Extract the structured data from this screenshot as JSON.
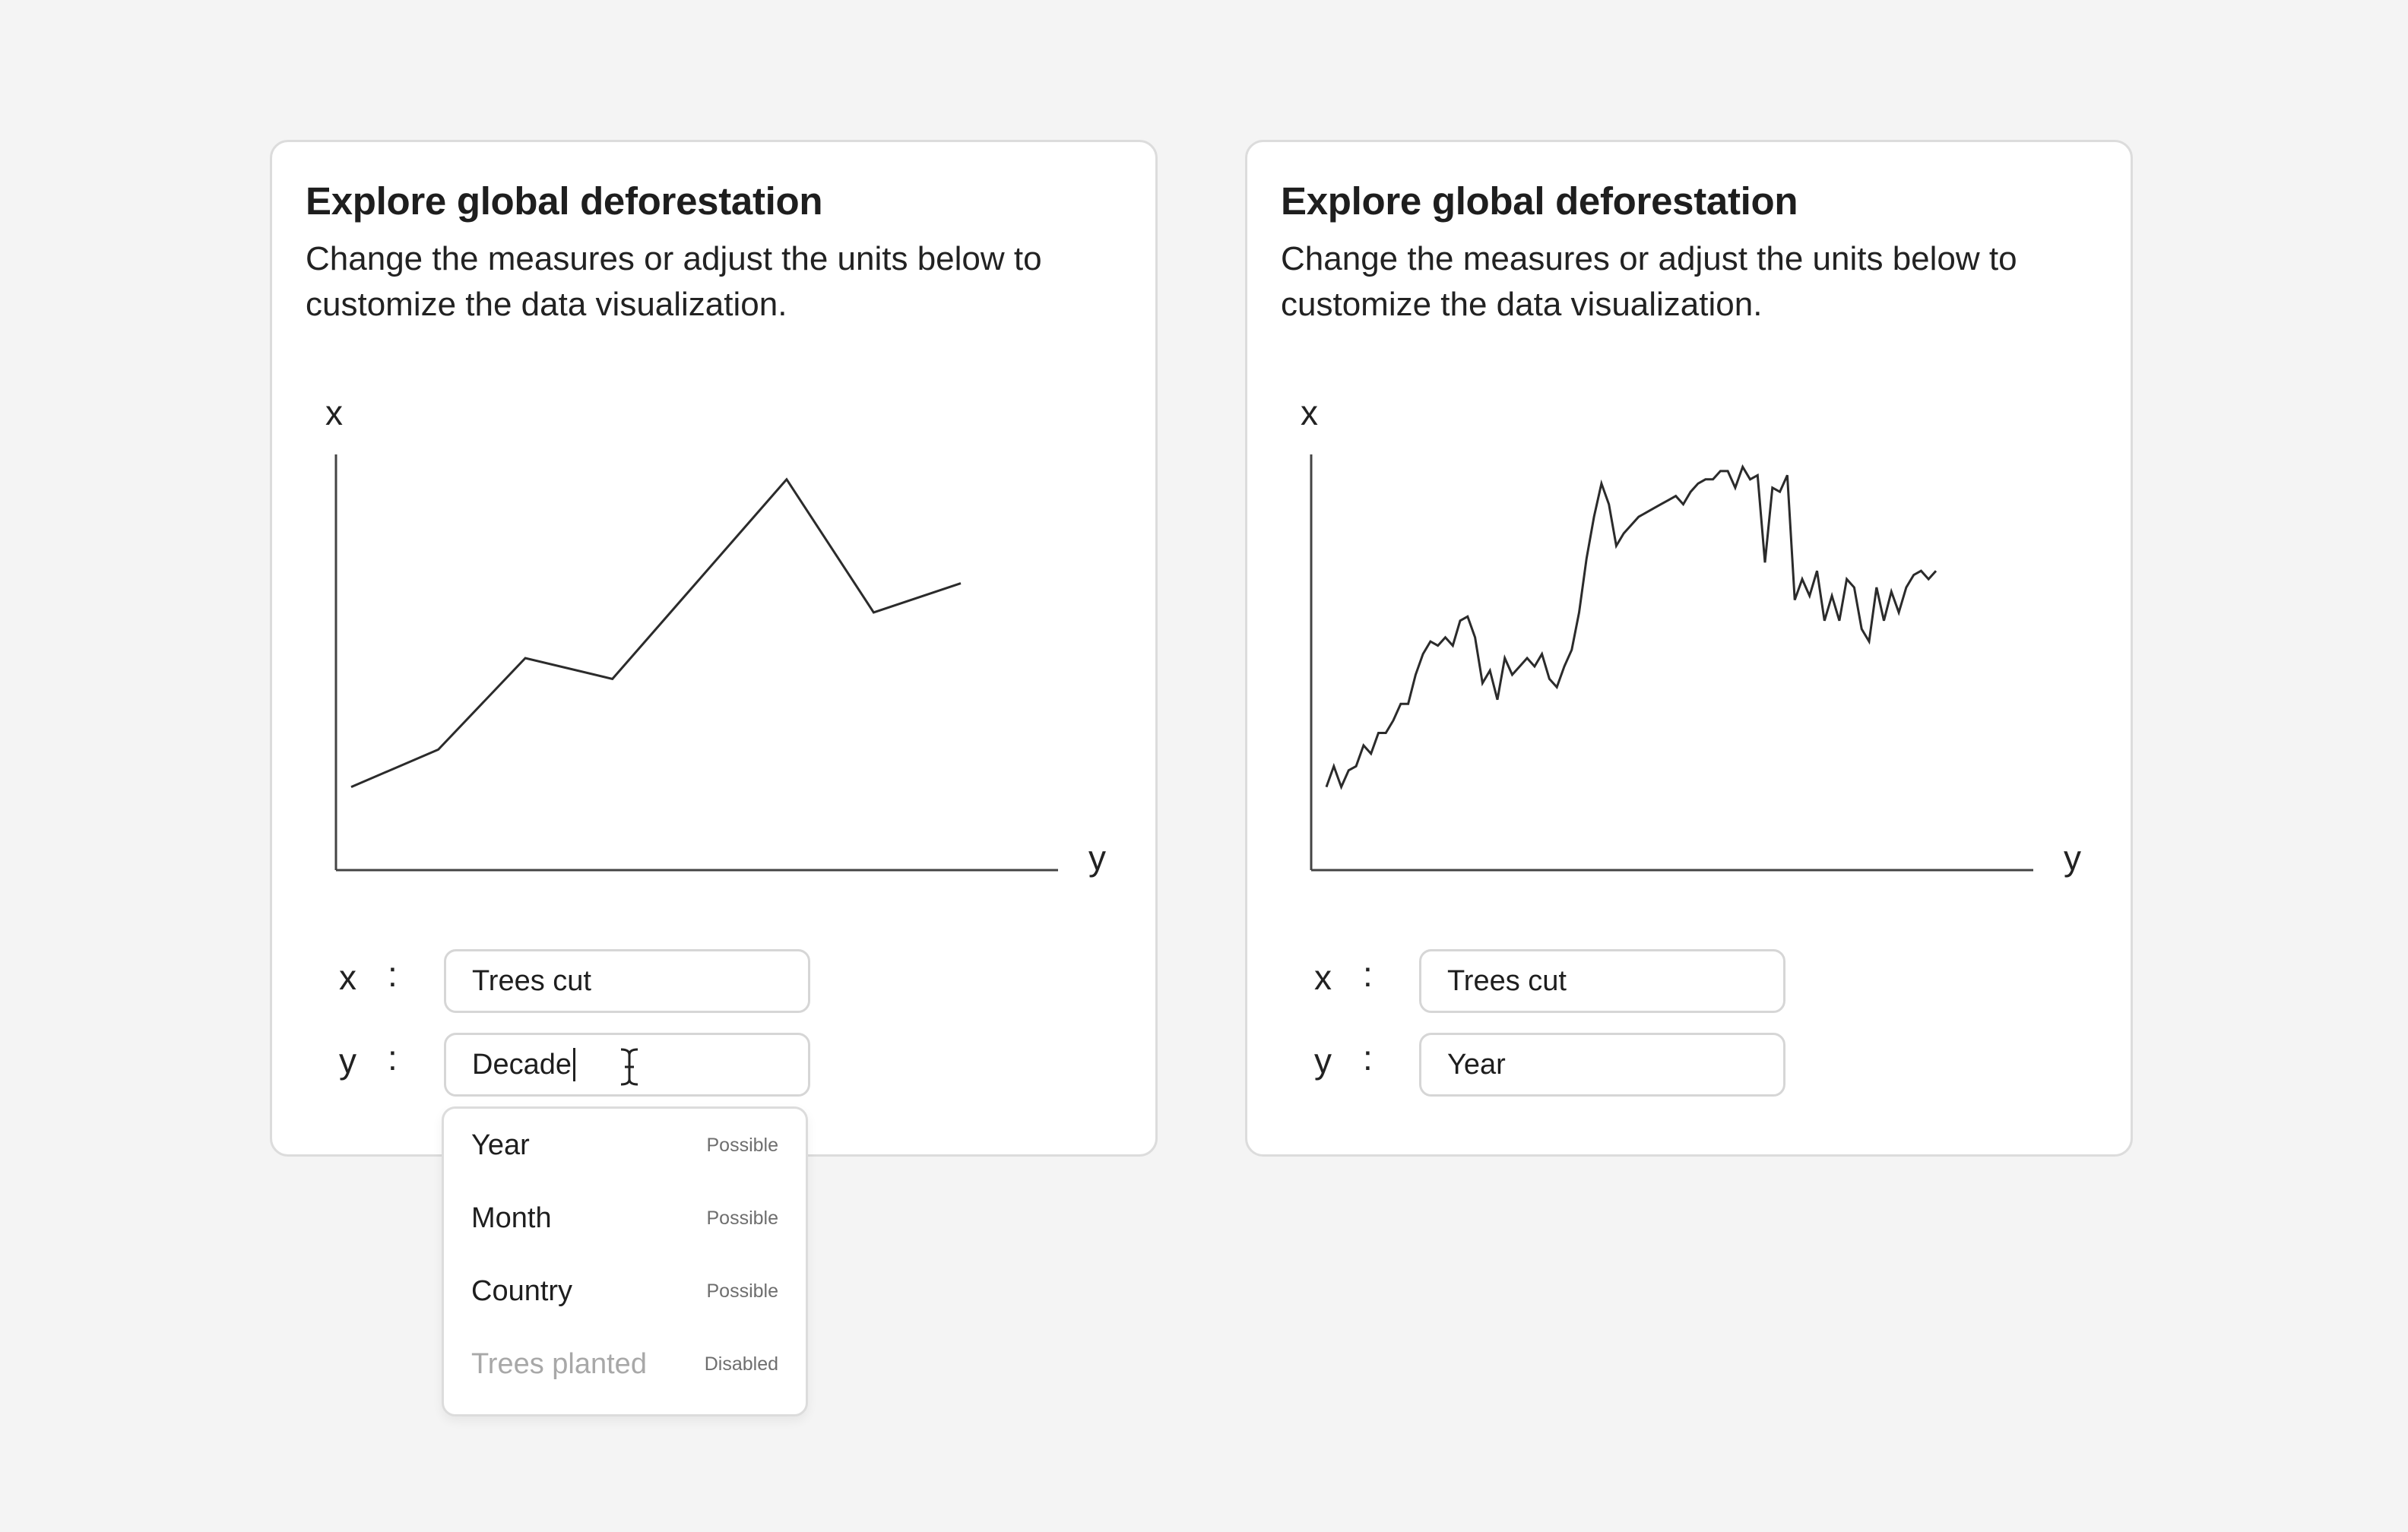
{
  "cards": [
    {
      "title": "Explore global deforestation",
      "description": "Change the measures or adjust the units below to customize the data visualization.",
      "fields": {
        "x_label": "x",
        "x_value": "Trees cut",
        "y_label": "y",
        "y_value": "Decade"
      },
      "dropdown": [
        {
          "label": "Year",
          "status": "Possible"
        },
        {
          "label": "Month",
          "status": "Possible"
        },
        {
          "label": "Country",
          "status": "Possible"
        },
        {
          "label": "Trees planted",
          "status": "Disabled"
        }
      ]
    },
    {
      "title": "Explore global deforestation",
      "description": "Change the measures or adjust the units below to customize the data visualization.",
      "fields": {
        "x_label": "x",
        "x_value": "Trees cut",
        "y_label": "y",
        "y_value": "Year"
      }
    }
  ],
  "chart_data": [
    {
      "type": "line",
      "title": "",
      "xlabel": "y",
      "ylabel": "x",
      "ylim": [
        0,
        100
      ],
      "series": [
        {
          "values": [
            20,
            29,
            51,
            46,
            70,
            94,
            62,
            69
          ]
        }
      ],
      "line_color": "#2b2b2b"
    },
    {
      "type": "line",
      "title": "",
      "xlabel": "y",
      "ylabel": "x",
      "ylim": [
        0,
        100
      ],
      "series": [
        {
          "values": [
            20,
            25,
            20,
            24,
            25,
            30,
            28,
            33,
            33,
            36,
            40,
            40,
            47,
            52,
            55,
            54,
            56,
            54,
            60,
            61,
            56,
            45,
            48,
            41,
            51,
            47,
            49,
            51,
            49,
            52,
            46,
            44,
            49,
            53,
            62,
            75,
            85,
            93,
            88,
            78,
            81,
            83,
            85,
            86,
            87,
            88,
            89,
            90,
            88,
            91,
            93,
            94,
            94,
            96,
            96,
            92,
            97,
            94,
            95,
            74,
            92,
            91,
            95,
            65,
            70,
            66,
            72,
            60,
            66,
            60,
            70,
            68,
            58,
            55,
            68,
            60,
            67,
            62,
            68,
            71,
            72,
            70,
            72
          ]
        }
      ],
      "line_color": "#2b2b2b"
    }
  ]
}
